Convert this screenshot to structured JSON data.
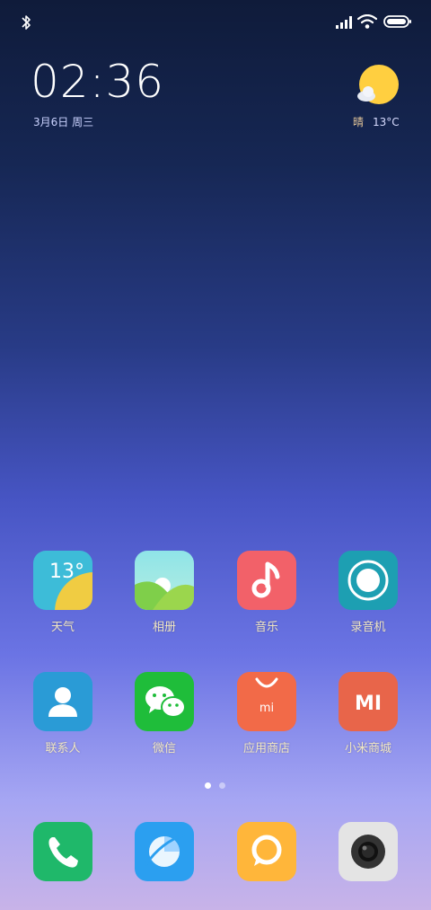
{
  "status": {
    "icons": [
      "bluetooth-icon",
      "cell-signal-icon",
      "wifi-icon",
      "battery-icon"
    ]
  },
  "clock": {
    "time": "02:36",
    "date": "3月6日 周三"
  },
  "weather": {
    "icon": "partly-sunny-icon",
    "condition": "晴",
    "temperature": "13°C"
  },
  "apps": {
    "row1": [
      {
        "label": "天气",
        "icon": "weather-icon",
        "badge": "13°"
      },
      {
        "label": "相册",
        "icon": "gallery-icon"
      },
      {
        "label": "音乐",
        "icon": "music-icon"
      },
      {
        "label": "录音机",
        "icon": "recorder-icon"
      }
    ],
    "row2": [
      {
        "label": "联系人",
        "icon": "contacts-icon"
      },
      {
        "label": "微信",
        "icon": "wechat-icon"
      },
      {
        "label": "应用商店",
        "icon": "app-store-icon",
        "badge": "mi"
      },
      {
        "label": "小米商城",
        "icon": "mi-store-icon",
        "badge": "MI"
      }
    ]
  },
  "dock": [
    {
      "icon": "phone-icon"
    },
    {
      "icon": "browser-icon"
    },
    {
      "icon": "messages-icon"
    },
    {
      "icon": "camera-icon"
    }
  ],
  "page_indicator": {
    "pages": 2,
    "current": 1
  }
}
